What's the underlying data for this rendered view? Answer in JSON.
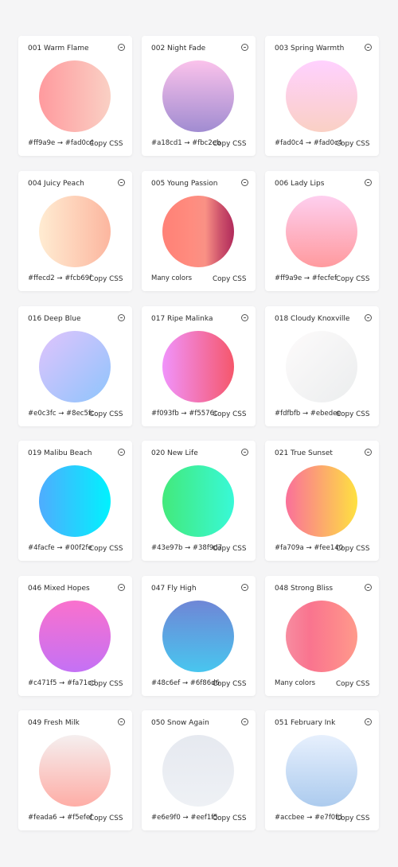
{
  "copy_label": "Copy CSS",
  "gradients": [
    {
      "title": "001 Warm Flame",
      "colors": "#ff9a9e → #fad0c4",
      "stops": [
        "#ff9a9e",
        "#fad0c4"
      ],
      "dir": "to right"
    },
    {
      "title": "002 Night Fade",
      "colors": "#a18cd1 → #fbc2eb",
      "stops": [
        "#fbc2eb",
        "#a18cd1"
      ],
      "dir": "to bottom"
    },
    {
      "title": "003 Spring Warmth",
      "colors": "#fad0c4 → #fad0c4",
      "stops": [
        "#ffd1ff",
        "#fad0c4"
      ],
      "dir": "to bottom"
    },
    {
      "title": "004 Juicy Peach",
      "colors": "#ffecd2 → #fcb69f",
      "stops": [
        "#ffecd2",
        "#fcb69f"
      ],
      "dir": "to right"
    },
    {
      "title": "005 Young Passion",
      "colors": "Many colors",
      "stops": [
        "#ff8177",
        "#ff867a",
        "#ff8c7f",
        "#f99185",
        "#cf556c",
        "#b12a5b"
      ],
      "dir": "to right"
    },
    {
      "title": "006 Lady Lips",
      "colors": "#ff9a9e → #fecfef",
      "stops": [
        "#fecfef",
        "#ff9a9e"
      ],
      "dir": "to bottom"
    },
    {
      "title": "016 Deep Blue",
      "colors": "#e0c3fc → #8ec5fc",
      "stops": [
        "#e0c3fc",
        "#8ec5fc"
      ],
      "dir": "135deg"
    },
    {
      "title": "017 Ripe Malinka",
      "colors": "#f093fb → #f5576c",
      "stops": [
        "#f093fb",
        "#f5576c"
      ],
      "dir": "to right"
    },
    {
      "title": "018 Cloudy Knoxville",
      "colors": "#fdfbfb → #ebedee",
      "stops": [
        "#fdfbfb",
        "#ebedee"
      ],
      "dir": "135deg"
    },
    {
      "title": "019 Malibu Beach",
      "colors": "#4facfe → #00f2fe",
      "stops": [
        "#4facfe",
        "#00f2fe"
      ],
      "dir": "to right"
    },
    {
      "title": "020 New Life",
      "colors": "#43e97b → #38f9d7",
      "stops": [
        "#43e97b",
        "#38f9d7"
      ],
      "dir": "to right"
    },
    {
      "title": "021 True Sunset",
      "colors": "#fa709a → #fee140",
      "stops": [
        "#fa709a",
        "#fee140"
      ],
      "dir": "to right"
    },
    {
      "title": "046 Mixed Hopes",
      "colors": "#c471f5 → #fa71cd",
      "stops": [
        "#fa71cd",
        "#c471f5"
      ],
      "dir": "to bottom"
    },
    {
      "title": "047 Fly High",
      "colors": "#48c6ef → #6f86d6",
      "stops": [
        "#6f86d6",
        "#48c6ef"
      ],
      "dir": "to bottom"
    },
    {
      "title": "048 Strong Bliss",
      "colors": "Many colors",
      "stops": [
        "#f78ca0",
        "#f9748f",
        "#fd868c",
        "#fe9a8b"
      ],
      "dir": "to right"
    },
    {
      "title": "049 Fresh Milk",
      "colors": "#feada6 → #f5efef",
      "stops": [
        "#f5efef",
        "#feada6"
      ],
      "dir": "to bottom"
    },
    {
      "title": "050 Snow Again",
      "colors": "#e6e9f0 → #eef1f5",
      "stops": [
        "#e6e9f0",
        "#eef1f5"
      ],
      "dir": "to bottom"
    },
    {
      "title": "051 February Ink",
      "colors": "#accbee → #e7f0fd",
      "stops": [
        "#e7f0fd",
        "#accbee"
      ],
      "dir": "to bottom"
    }
  ]
}
